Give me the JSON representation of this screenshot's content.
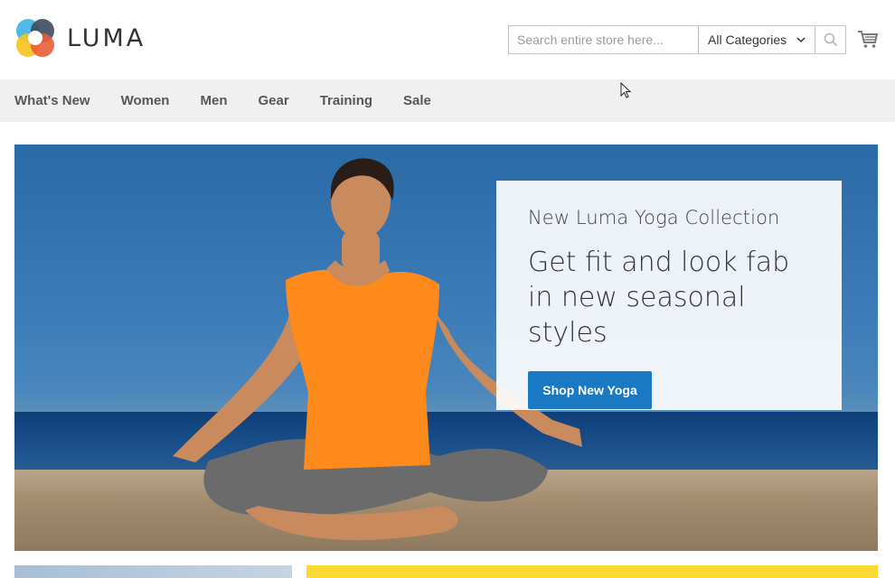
{
  "brand": {
    "name": "LUMA",
    "logo_colors": [
      "#f7c31d",
      "#3db3e4",
      "#ea5d37",
      "#3c4b5f"
    ]
  },
  "search": {
    "placeholder": "Search entire store here...",
    "category": "All Categories"
  },
  "nav": {
    "items": [
      "What's New",
      "Women",
      "Men",
      "Gear",
      "Training",
      "Sale"
    ]
  },
  "hero": {
    "subtitle": "New Luma Yoga Collection",
    "title": "Get fit and look fab in new seasonal styles",
    "button_label": "Shop New Yoga"
  },
  "colors": {
    "accent": "#1979c3",
    "nav_bg": "#f0f0f0",
    "promo_strip": "#fbdb33"
  },
  "icons": {
    "search": "search-icon",
    "cart": "cart-icon",
    "chevron": "chevron-down-icon"
  }
}
